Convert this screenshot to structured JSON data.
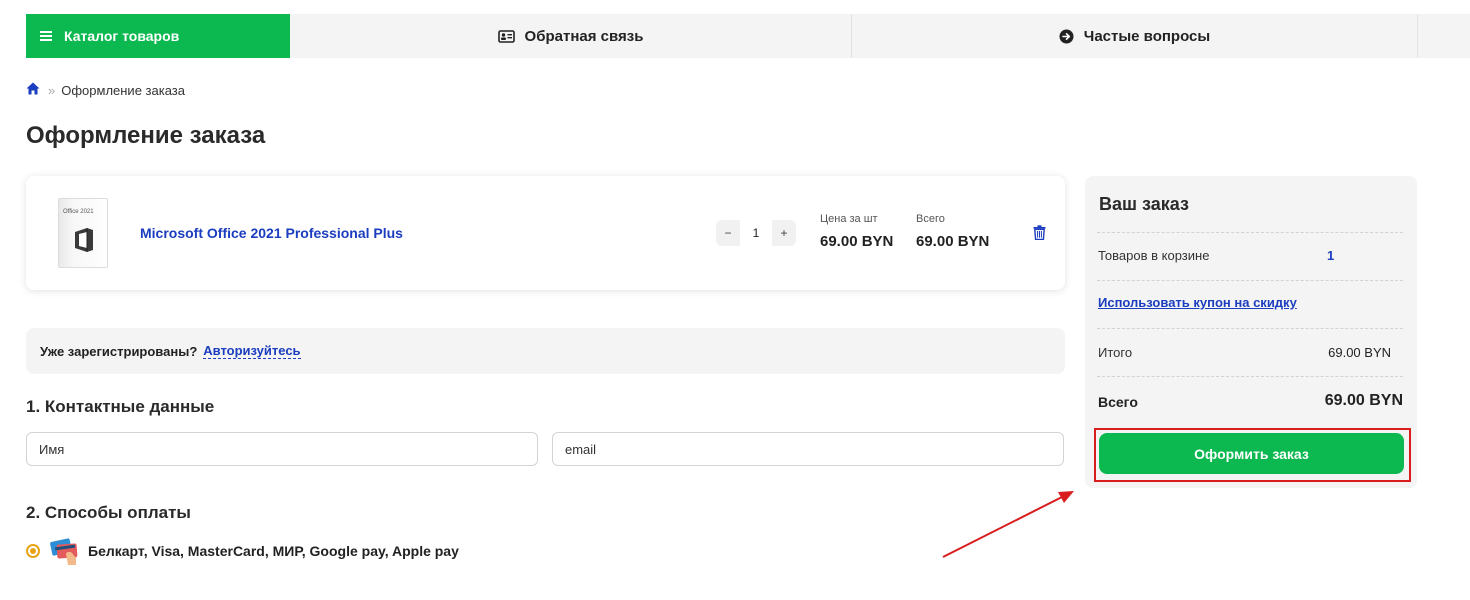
{
  "nav": {
    "catalog_label": "Каталог товаров",
    "feedback_label": "Обратная связь",
    "faq_label": "Частые вопросы"
  },
  "breadcrumb": {
    "current": "Оформление заказа"
  },
  "page": {
    "title": "Оформление заказа"
  },
  "product": {
    "image_caption": "Office 2021",
    "name": "Microsoft Office 2021 Professional Plus",
    "quantity": "1",
    "qty_minus": "−",
    "qty_plus": "+",
    "unit_price_label": "Цена за шт",
    "unit_price": "69.00 BYN",
    "total_label": "Всего",
    "total": "69.00 BYN"
  },
  "login": {
    "prompt": "Уже зарегистрированы?",
    "link": "Авторизуйтесь"
  },
  "contact": {
    "title": "1. Контактные данные",
    "name_placeholder": "Имя",
    "email_placeholder": "email"
  },
  "payment": {
    "title": "2. Способы оплаты",
    "option": "Белкарт, Visa, MasterCard, МИР, Google pay, Apple pay"
  },
  "summary": {
    "title": "Ваш заказ",
    "items_label": "Товаров в корзине",
    "items_count": "1",
    "coupon_link": "Использовать купон на скидку",
    "subtotal_label": "Итого",
    "subtotal_value": "69.00 BYN",
    "total_label": "Всего",
    "total_value": "69.00 BYN",
    "checkout_label": "Оформить заказ"
  },
  "colors": {
    "brand_green": "#0cb950",
    "link_blue": "#1b3dbf",
    "highlight_red": "#d91c1c",
    "radio_orange": "#e8a317"
  },
  "icons": [
    "menu-icon",
    "id-card-icon",
    "arrow-circle-right-icon",
    "home-icon",
    "trash-icon",
    "payment-cards-icon",
    "office-logo-icon"
  ]
}
